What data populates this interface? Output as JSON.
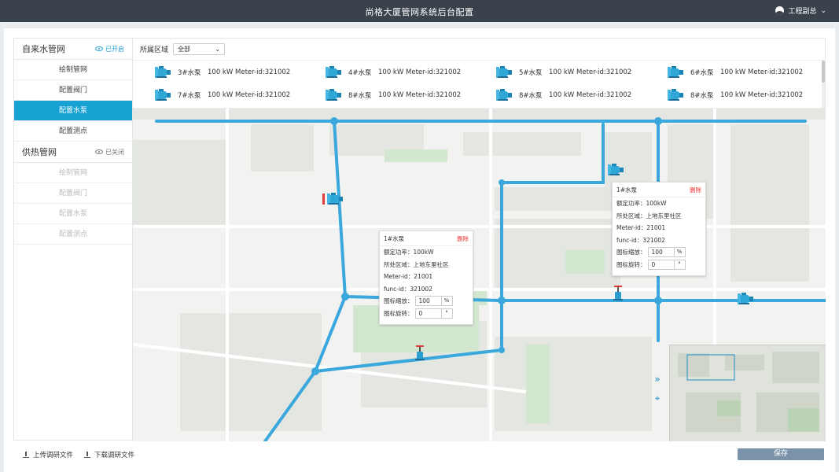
{
  "header": {
    "title": "尚格大厦管网系统后台配置",
    "user": "工程副总"
  },
  "sidebar": {
    "groups": [
      {
        "title": "自来水管网",
        "status": "已开启",
        "items": [
          "绘制管网",
          "配置阀门",
          "配置水泵",
          "配置测点"
        ]
      },
      {
        "title": "供热管网",
        "status": "已关闭",
        "items": [
          "绘制管网",
          "配置阀门",
          "配置水泵",
          "配置测点"
        ]
      }
    ]
  },
  "filter": {
    "label": "所属区域",
    "value": "全部"
  },
  "pumps": [
    {
      "name": "3#水泵",
      "power": "100 kW",
      "meter": "Meter-id:321002"
    },
    {
      "name": "4#水泵",
      "power": "100 kW",
      "meter": "Meter-id:321002"
    },
    {
      "name": "5#水泵",
      "power": "100 kW",
      "meter": "Meter-id:321002"
    },
    {
      "name": "6#水泵",
      "power": "100 kW",
      "meter": "Meter-id:321002"
    },
    {
      "name": "7#水泵",
      "power": "100 kW",
      "meter": "Meter-id:321002"
    },
    {
      "name": "8#水泵",
      "power": "100 kW",
      "meter": "Meter-id:321002"
    },
    {
      "name": "8#水泵",
      "power": "100 kW",
      "meter": "Meter-id:321002"
    },
    {
      "name": "8#水泵",
      "power": "100 kW",
      "meter": "Meter-id:321002"
    }
  ],
  "popups": [
    {
      "title": "1#水泵",
      "delete": "删除",
      "power": "额定功率：100kW",
      "area": "所处区域：上地东里社区",
      "meter": "Meter-id：21001",
      "func": "func-id：321002",
      "scale_label": "图标缩放：",
      "scale": "100",
      "scale_unit": "%",
      "rotate_label": "图标旋转：",
      "rotate": "0",
      "rotate_unit": "°"
    },
    {
      "title": "1#水泵",
      "delete": "删除",
      "power": "额定功率：100kW",
      "area": "所处区域：上地东里社区",
      "meter": "Meter-id：21001",
      "func": "func-id：321002",
      "scale_label": "图标缩放：",
      "scale": "100",
      "scale_unit": "%",
      "rotate_label": "图标旋转：",
      "rotate": "0",
      "rotate_unit": "°"
    }
  ],
  "footer": {
    "upload": "上传调研文件",
    "download": "下载调研文件",
    "save": "保存"
  },
  "colors": {
    "pipe": "#3aa8dc",
    "accent": "#18a2d3",
    "topbar": "#3a434b",
    "valve": "#e03a3a"
  }
}
